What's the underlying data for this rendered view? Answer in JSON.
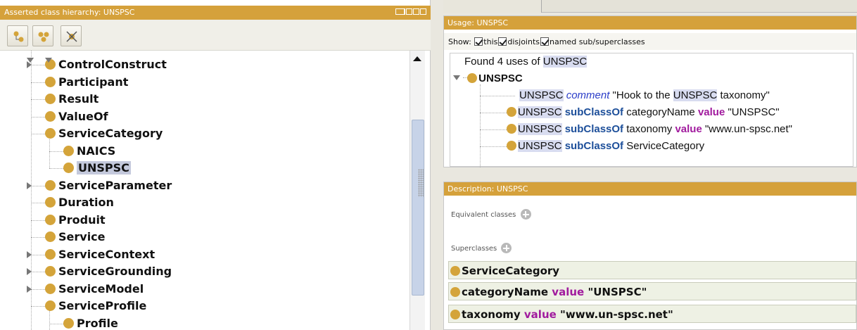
{
  "left_panel": {
    "title": "Asserted class hierarchy: UNSPSC",
    "toolbar": [
      "add-subclass-icon",
      "add-sibling-icon",
      "delete-class-icon"
    ],
    "tree": [
      {
        "label": "ControlConstruct",
        "expandable": true,
        "expanded": false
      },
      {
        "label": "Participant",
        "expandable": false
      },
      {
        "label": "Result",
        "expandable": false
      },
      {
        "label": "ValueOf",
        "expandable": false
      },
      {
        "label": "ServiceCategory",
        "expandable": true,
        "expanded": true
      },
      {
        "label": "NAICS",
        "expandable": false
      },
      {
        "label": "UNSPSC",
        "expandable": false,
        "selected": true
      },
      {
        "label": "ServiceParameter",
        "expandable": true,
        "expanded": false
      },
      {
        "label": "Duration",
        "expandable": false
      },
      {
        "label": "Produit",
        "expandable": false
      },
      {
        "label": "Service",
        "expandable": false
      },
      {
        "label": "ServiceContext",
        "expandable": true,
        "expanded": false
      },
      {
        "label": "ServiceGrounding",
        "expandable": true,
        "expanded": false
      },
      {
        "label": "ServiceModel",
        "expandable": true,
        "expanded": false
      },
      {
        "label": "ServiceProfile",
        "expandable": true,
        "expanded": true
      },
      {
        "label": "Profile",
        "expandable": true,
        "expanded": true
      }
    ]
  },
  "usage_panel": {
    "title": "Usage: UNSPSC",
    "show_label": "Show:",
    "options": [
      "this",
      "disjoints",
      "named sub/superclasses"
    ],
    "found_prefix": "Found 4 uses of",
    "found_term": "UNSPSC",
    "root": "UNSPSC",
    "rows": [
      {
        "subject": "UNSPSC",
        "keyword": "comment",
        "rest": "\"Hook to the",
        "term": "UNSPSC",
        "tail": "taxonomy\""
      },
      {
        "subject": "UNSPSC",
        "keyword": "subClassOf",
        "prop": "categoryName",
        "val_kw": "value",
        "value": "\"UNSPSC\""
      },
      {
        "subject": "UNSPSC",
        "keyword": "subClassOf",
        "prop": "taxonomy",
        "val_kw": "value",
        "value": "\"www.un-spsc.net\""
      },
      {
        "subject": "UNSPSC",
        "keyword": "subClassOf",
        "prop": "ServiceCategory"
      }
    ]
  },
  "description_panel": {
    "title": "Description: UNSPSC",
    "equivalent_label": "Equivalent classes",
    "superclasses_label": "Superclasses",
    "superclasses": [
      {
        "name": "ServiceCategory"
      },
      {
        "name": "categoryName",
        "val_kw": "value",
        "value": "\"UNSPSC\""
      },
      {
        "name": "taxonomy",
        "val_kw": "value",
        "value": "\"www.un-spsc.net\""
      }
    ]
  },
  "colors": {
    "header": "#d5a13b",
    "class_dot": "#d4a43a",
    "highlight": "#d8dcf0",
    "keyword": "#1d4f9a",
    "value_keyword": "#a11b9e"
  }
}
